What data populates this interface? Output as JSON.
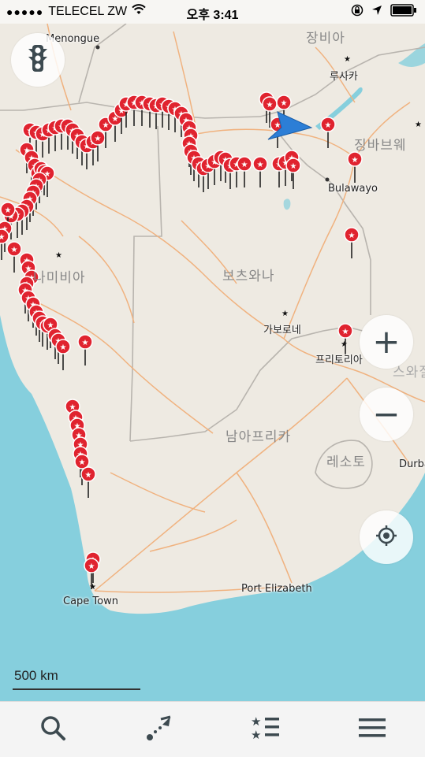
{
  "status": {
    "carrier": "TELECEL ZW",
    "time": "오후 3:41",
    "icons": [
      "signal-dots-icon",
      "wifi-icon",
      "lock-rotation-icon",
      "location-arrow-icon",
      "battery-icon"
    ]
  },
  "map": {
    "labels": {
      "menongue": "Menongue",
      "zambia": "장비아",
      "lusaka": "루사카",
      "zimbabwe": "징바브웨",
      "bulawayo": "Bulawayo",
      "namibia": "나미비아",
      "botswana": "보츠와나",
      "gaborone": "가보로네",
      "pretoria": "프리토리아",
      "swaziland": "스와질",
      "south_africa": "남아프리카",
      "lesotho": "레소토",
      "durban": "Durba",
      "cape_town": "Cape Town",
      "port_elizabeth": "Port Elizabeth"
    },
    "colors": {
      "land": "#eeeae2",
      "water": "#86cfdd",
      "road": "#f0b27f",
      "border": "#b8b4ae",
      "pin": "#e0232f",
      "arrow": "#2c7ed6"
    }
  },
  "controls": {
    "traffic_icon": "traffic-light-icon",
    "zoom_in": "+",
    "zoom_out": "−",
    "locate_icon": "crosshair-icon"
  },
  "scale": {
    "label": "500 km"
  },
  "toolbar": {
    "icons": [
      "search-icon",
      "route-icon",
      "bookmarks-list-icon",
      "menu-icon"
    ]
  }
}
